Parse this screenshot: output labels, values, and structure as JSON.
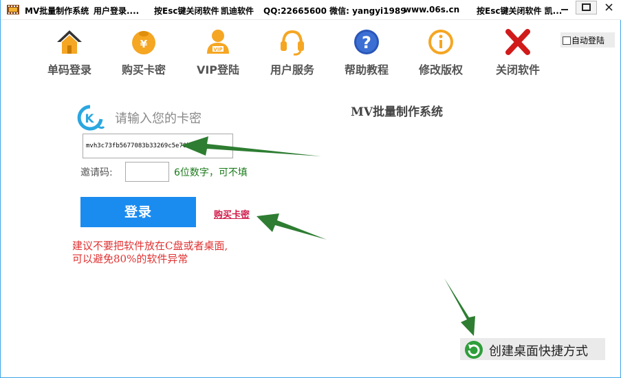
{
  "titlebar": {
    "app_name": "MV批量制作系统",
    "user_status": "用户登录....",
    "esc_hint": "按Esc键关闭软件",
    "vendor": "凯迪软件",
    "contact": "QQ:22665600 微信: yangyi1989",
    "website": "www.06s.cn",
    "esc_hint_repeat": "按Esc键关闭软件  凯..."
  },
  "toolbar": {
    "items": [
      {
        "label": "单码登录",
        "icon": "home-icon"
      },
      {
        "label": "购买卡密",
        "icon": "money-bag-icon"
      },
      {
        "label": "VIP登陆",
        "icon": "vip-user-icon"
      },
      {
        "label": "用户服务",
        "icon": "headset-icon"
      },
      {
        "label": "帮助教程",
        "icon": "help-icon"
      },
      {
        "label": "修改版权",
        "icon": "info-icon"
      },
      {
        "label": "关闭软件",
        "icon": "close-x-icon"
      }
    ]
  },
  "auto_login": {
    "label": "自动登陆",
    "checked": false
  },
  "login": {
    "prompt": "请输入您的卡密",
    "card_value": "mvh3c73fb5677083b33269c5e70ba3c",
    "invite_label": "邀请码:",
    "invite_value": "",
    "invite_hint": "6位数字，可不填",
    "login_button": "登录",
    "buy_link": "购买卡密"
  },
  "warning": {
    "line1": "建议不要把软件放在C盘或者桌面,",
    "line2": "可以避免80%的软件异常"
  },
  "app_heading": "MV批量制作系统",
  "shortcut": {
    "label": "创建桌面快捷方式"
  },
  "colors": {
    "accent_blue": "#1a8cf0",
    "link_red": "#d01c4a",
    "hint_green": "#1a7a1a",
    "warning_red": "#e03232",
    "arrow_green": "#2e7d32"
  }
}
